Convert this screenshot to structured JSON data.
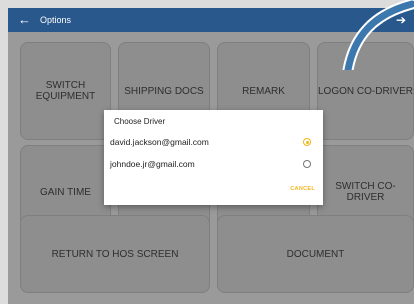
{
  "appbar": {
    "title": "Options",
    "back_icon": "arrow-left-icon",
    "action_icons": [
      "help-icon",
      "settings-icon",
      "logout-icon"
    ]
  },
  "tiles": [
    "SWITCH EQUIPMENT",
    "SHIPPING DOCS",
    "REMARK",
    "LOGON CO-DRIVER",
    "GAIN TIME",
    "SWITCH CO-DRIVER",
    "RETURN TO HOS SCREEN",
    "DOCUMENT"
  ],
  "dialog": {
    "title": "Choose Driver",
    "options": [
      {
        "label": "david.jackson@gmail.com",
        "selected": true
      },
      {
        "label": "johndoe.jr@gmail.com",
        "selected": false
      }
    ],
    "cancel_label": "CANCEL"
  },
  "colors": {
    "appbar": "#29588c",
    "accent": "#f2b51c",
    "annotation_arrow": "#3c78ad"
  }
}
